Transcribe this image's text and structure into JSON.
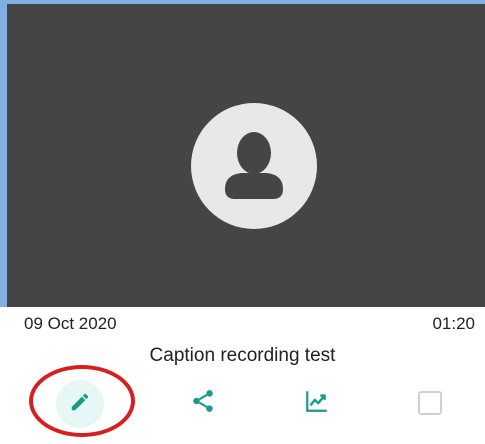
{
  "recording": {
    "date": "09 Oct 2020",
    "duration": "01:20",
    "title": "Caption recording test"
  },
  "icons": {
    "thumbnail": "user-placeholder-icon",
    "edit": "pencil-icon",
    "share": "share-icon",
    "stats": "line-chart-icon",
    "select": "checkbox-icon"
  },
  "colors": {
    "accent": "#1a9a8a",
    "thumbnail_bg": "#454545",
    "selection_border": "#7fb0e0",
    "annotation": "#d62020"
  }
}
